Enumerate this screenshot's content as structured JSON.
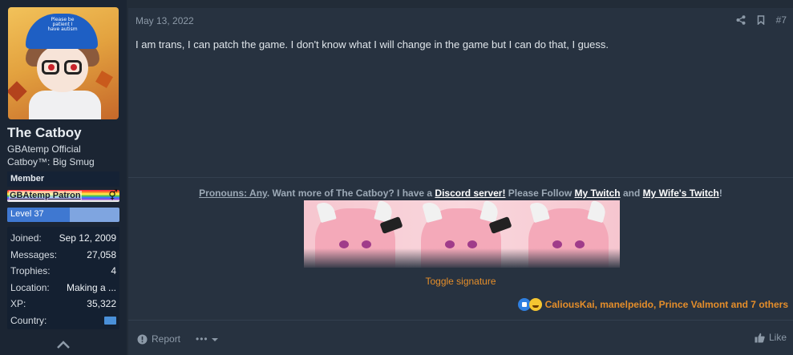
{
  "user": {
    "avatar_hat_text": "Please be patient I have autism",
    "name": "The Catboy",
    "title_line1": "GBAtemp Official",
    "title_line2": "Catboy™: Big Smug",
    "banner_member": "Member",
    "banner_patron": "GBAtemp Patron",
    "gender_symbol": "⚥",
    "level_label": "Level 37",
    "level_progress_fraction": 0.56,
    "stats": [
      {
        "key": "Joined:",
        "value": "Sep 12, 2009"
      },
      {
        "key": "Messages:",
        "value": "27,058"
      },
      {
        "key": "Trophies:",
        "value": "4"
      },
      {
        "key": "Location:",
        "value": "Making a ..."
      },
      {
        "key": "XP:",
        "value": "35,322"
      },
      {
        "key": "Country:",
        "value": ""
      }
    ],
    "country_flag_color": "#4a90d9"
  },
  "message": {
    "date": "May 13, 2022",
    "post_number": "#7",
    "text": "I am trans, I can patch the game. I don't know what I will change in the game but I can do that, I guess."
  },
  "signature": {
    "pronouns_link": "Pronouns: Any",
    "text_a": ". Want more of The Catboy? I have a ",
    "discord_link": "Discord server!",
    "text_b": " Please Follow ",
    "twitch_link": "My Twitch",
    "text_c": " and ",
    "wife_twitch_link": "My Wife's Twitch",
    "text_d": "!",
    "toggle_label": "Toggle signature"
  },
  "reactions": {
    "users_text": "CaliousKai, manelpeido, Prince Valmont and 7 others"
  },
  "footer": {
    "report_label": "Report",
    "more_label": "•••",
    "like_label": "Like"
  },
  "colors": {
    "accent_orange": "#e58e2a",
    "level_blue": "#3f78d1",
    "panel_bg": "#273240",
    "sidebar_bg": "#1b2533"
  }
}
